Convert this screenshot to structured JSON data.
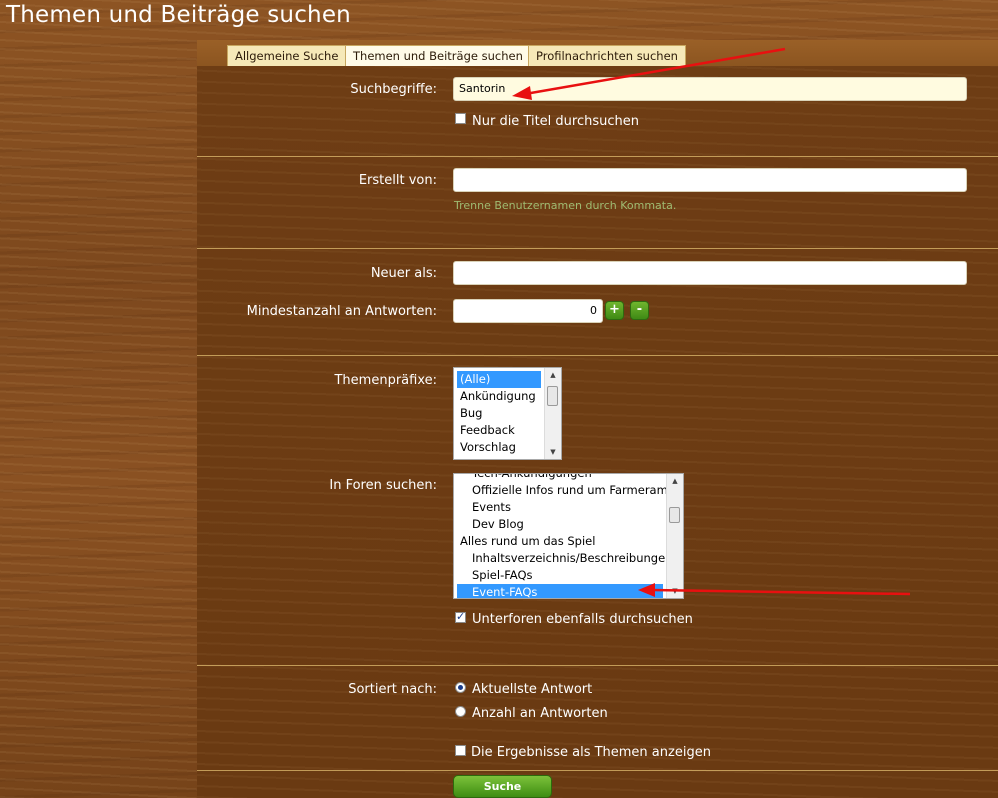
{
  "page": {
    "title": "Themen und Beiträge suchen"
  },
  "tabs": [
    {
      "label": "Allgemeine Suche"
    },
    {
      "label": "Themen und Beiträge suchen",
      "active": true
    },
    {
      "label": "Profilnachrichten suchen"
    }
  ],
  "search": {
    "label": "Suchbegriffe:",
    "value": "Santorin",
    "titles_only_label": "Nur die Titel durchsuchen",
    "titles_only_checked": false
  },
  "created_by": {
    "label": "Erstellt von:",
    "value": "",
    "hint": "Trenne Benutzernamen durch Kommata."
  },
  "newer_than": {
    "label": "Neuer als:",
    "value": ""
  },
  "min_replies": {
    "label": "Mindestanzahl an Antworten:",
    "value": "0",
    "plus": "+",
    "minus": "-"
  },
  "prefixes": {
    "label": "Themenpräfixe:",
    "options": [
      "(Alle)",
      "Ankündigung",
      "Bug",
      "Feedback",
      "Vorschlag"
    ],
    "selected": "(Alle)"
  },
  "forums": {
    "label": "In Foren suchen:",
    "options": [
      "Tech-Ankündigungen",
      "Offizielle Infos rund um Farmerama",
      "Events",
      "Dev Blog",
      "Alles rund um das Spiel",
      "Inhaltsverzeichnis/Beschreibungen",
      "Spiel-FAQs",
      "Event-FAQs"
    ],
    "selected": "Event-FAQs",
    "include_subforums_label": "Unterforen ebenfalls durchsuchen",
    "include_subforums_checked": true
  },
  "sort": {
    "label": "Sortiert nach:",
    "options": [
      "Aktuellste Antwort",
      "Anzahl an Antworten"
    ],
    "selected": "Aktuellste Antwort"
  },
  "show_as_threads": {
    "label": "Die Ergebnisse als Themen anzeigen",
    "checked": false
  },
  "submit_label": "Suche",
  "colors": {
    "annotation_arrow": "#e81010",
    "selection": "#3399ff",
    "button_green": "#4a9a1a"
  }
}
